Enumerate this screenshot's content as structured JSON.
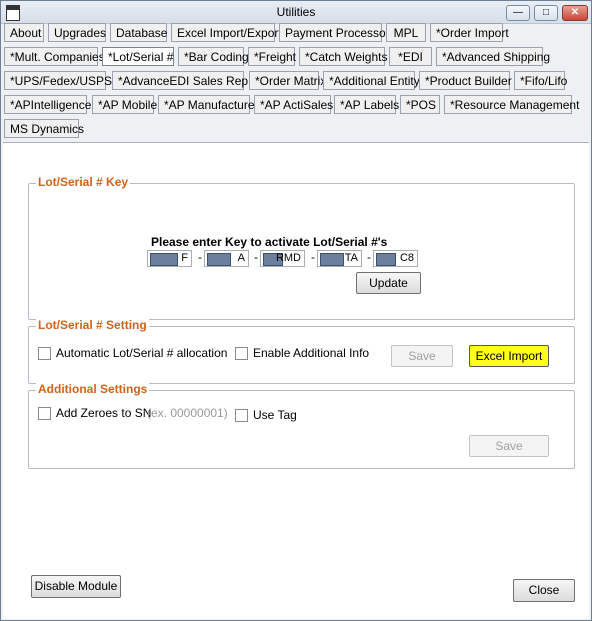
{
  "window": {
    "title": "Utilities",
    "minimize_glyph": "—",
    "maximize_glyph": "□",
    "close_glyph": "✕"
  },
  "tabs": [
    "About",
    "Upgrades",
    "Database",
    "Excel Import/Export",
    "Payment Processor",
    "MPL",
    "*Order Import",
    "*Mult. Companies",
    "*Lot/Serial #",
    "*Bar Coding",
    "*Freight",
    "*Catch Weights",
    "*EDI",
    "*Advanced Shipping",
    "*UPS/Fedex/USPS",
    "*AdvanceEDI Sales Rep.",
    "*Order Matrix",
    "*Additional Entity",
    "*Product Builder",
    "*Fifo/Lifo",
    "*APIntelligence",
    "*AP Mobile",
    "*AP Manufacture",
    "*AP ActiSales",
    "*AP Labels",
    "*POS",
    "*Resource Management",
    "MS Dynamics"
  ],
  "active_tab": "*Lot/Serial #",
  "key_group": {
    "title": "Lot/Serial # Key",
    "prompt": "Please enter Key  to activate Lot/Serial #'s",
    "fields": [
      "F",
      "A",
      "RMD",
      "TA",
      "C8"
    ],
    "separator": "-",
    "update_label": "Update"
  },
  "setting_group": {
    "title": "Lot/Serial # Setting",
    "auto_allocation_label": "Automatic Lot/Serial # allocation",
    "enable_info_label": "Enable Additional Info",
    "save_label": "Save",
    "excel_import_label": "Excel Import"
  },
  "additional_group": {
    "title": "Additional Settings",
    "add_zeroes_label": "Add Zeroes to SN",
    "add_zeroes_example": "(ex. 00000001)",
    "use_tag_label": "Use Tag",
    "save_label": "Save"
  },
  "footer": {
    "disable_label": "Disable Module",
    "close_label": "Close"
  },
  "colors": {
    "group_title": "#d0621a",
    "highlight": "#ffff1a"
  }
}
